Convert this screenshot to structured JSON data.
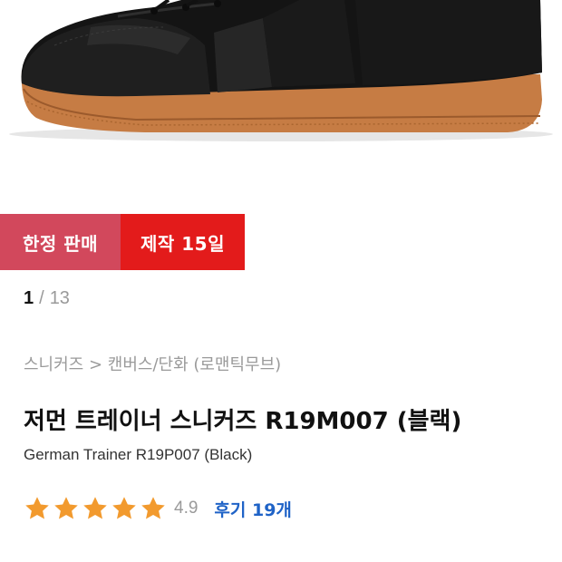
{
  "product_image": {
    "alt": "black leather sneaker with gum sole"
  },
  "badges": {
    "limited": "한정 판매",
    "production": "제작 15일",
    "colors": {
      "limited": "#d2485c",
      "production": "#e31b1b"
    }
  },
  "pager": {
    "current": "1",
    "separator": "/",
    "total": "13"
  },
  "breadcrumb": "스니커즈 > 캔버스/단화 (로맨틱무브)",
  "product": {
    "title_ko": "저먼 트레이너 스니커즈 R19M007 (블랙)",
    "title_en": "German Trainer R19P007 (Black)"
  },
  "rating": {
    "stars": 5,
    "star_color": "#f29a2e",
    "score": "4.9",
    "reviews_label": "후기 19개",
    "link_color": "#1f63c7"
  }
}
